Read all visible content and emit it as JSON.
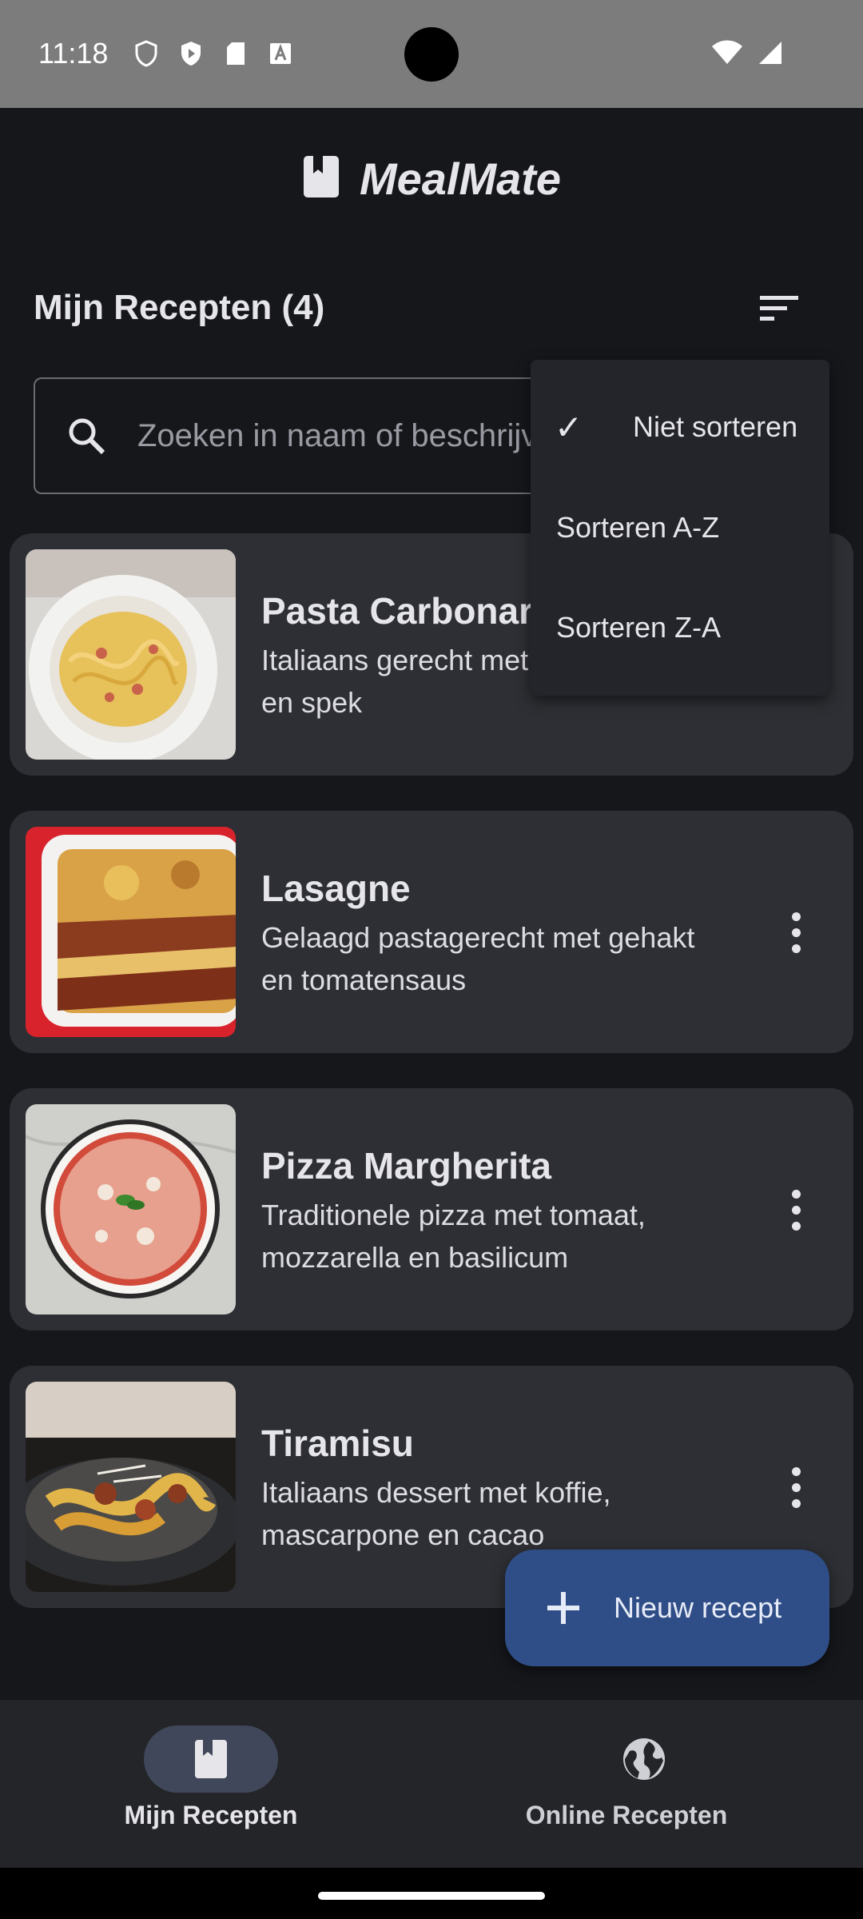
{
  "status": {
    "time": "11:18"
  },
  "app": {
    "title": "MealMate"
  },
  "section": {
    "heading": "Mijn Recepten (4)"
  },
  "search": {
    "placeholder": "Zoeken in naam of beschrijving",
    "value": ""
  },
  "sort_menu": {
    "items": [
      {
        "label": "Niet sorteren",
        "checked": true
      },
      {
        "label": "Sorteren A-Z",
        "checked": false
      },
      {
        "label": "Sorteren Z-A",
        "checked": false
      }
    ],
    "check_glyph": "✓"
  },
  "recipes": [
    {
      "title": "Pasta Carbonara",
      "description": "Italiaans gerecht met eieren, kaas en spek",
      "image": "pasta"
    },
    {
      "title": "Lasagne",
      "description": "Gelaagd pastagerecht met gehakt en tomatensaus",
      "image": "lasagne"
    },
    {
      "title": "Pizza Margherita",
      "description": "Traditionele pizza met tomaat, mozzarella en basilicum",
      "image": "pizza"
    },
    {
      "title": "Tiramisu",
      "description": "Italiaans dessert met koffie, mascarpone en cacao",
      "image": "pasta-dish"
    }
  ],
  "fab": {
    "label": "Nieuw recept"
  },
  "nav": {
    "items": [
      {
        "label": "Mijn Recepten",
        "icon": "book-icon",
        "active": true
      },
      {
        "label": "Online Recepten",
        "icon": "globe-icon",
        "active": false
      }
    ]
  },
  "colors": {
    "background": "#16171b",
    "card": "#2e2f34",
    "fab": "#2f4d86",
    "nav_pill": "#40475a"
  }
}
